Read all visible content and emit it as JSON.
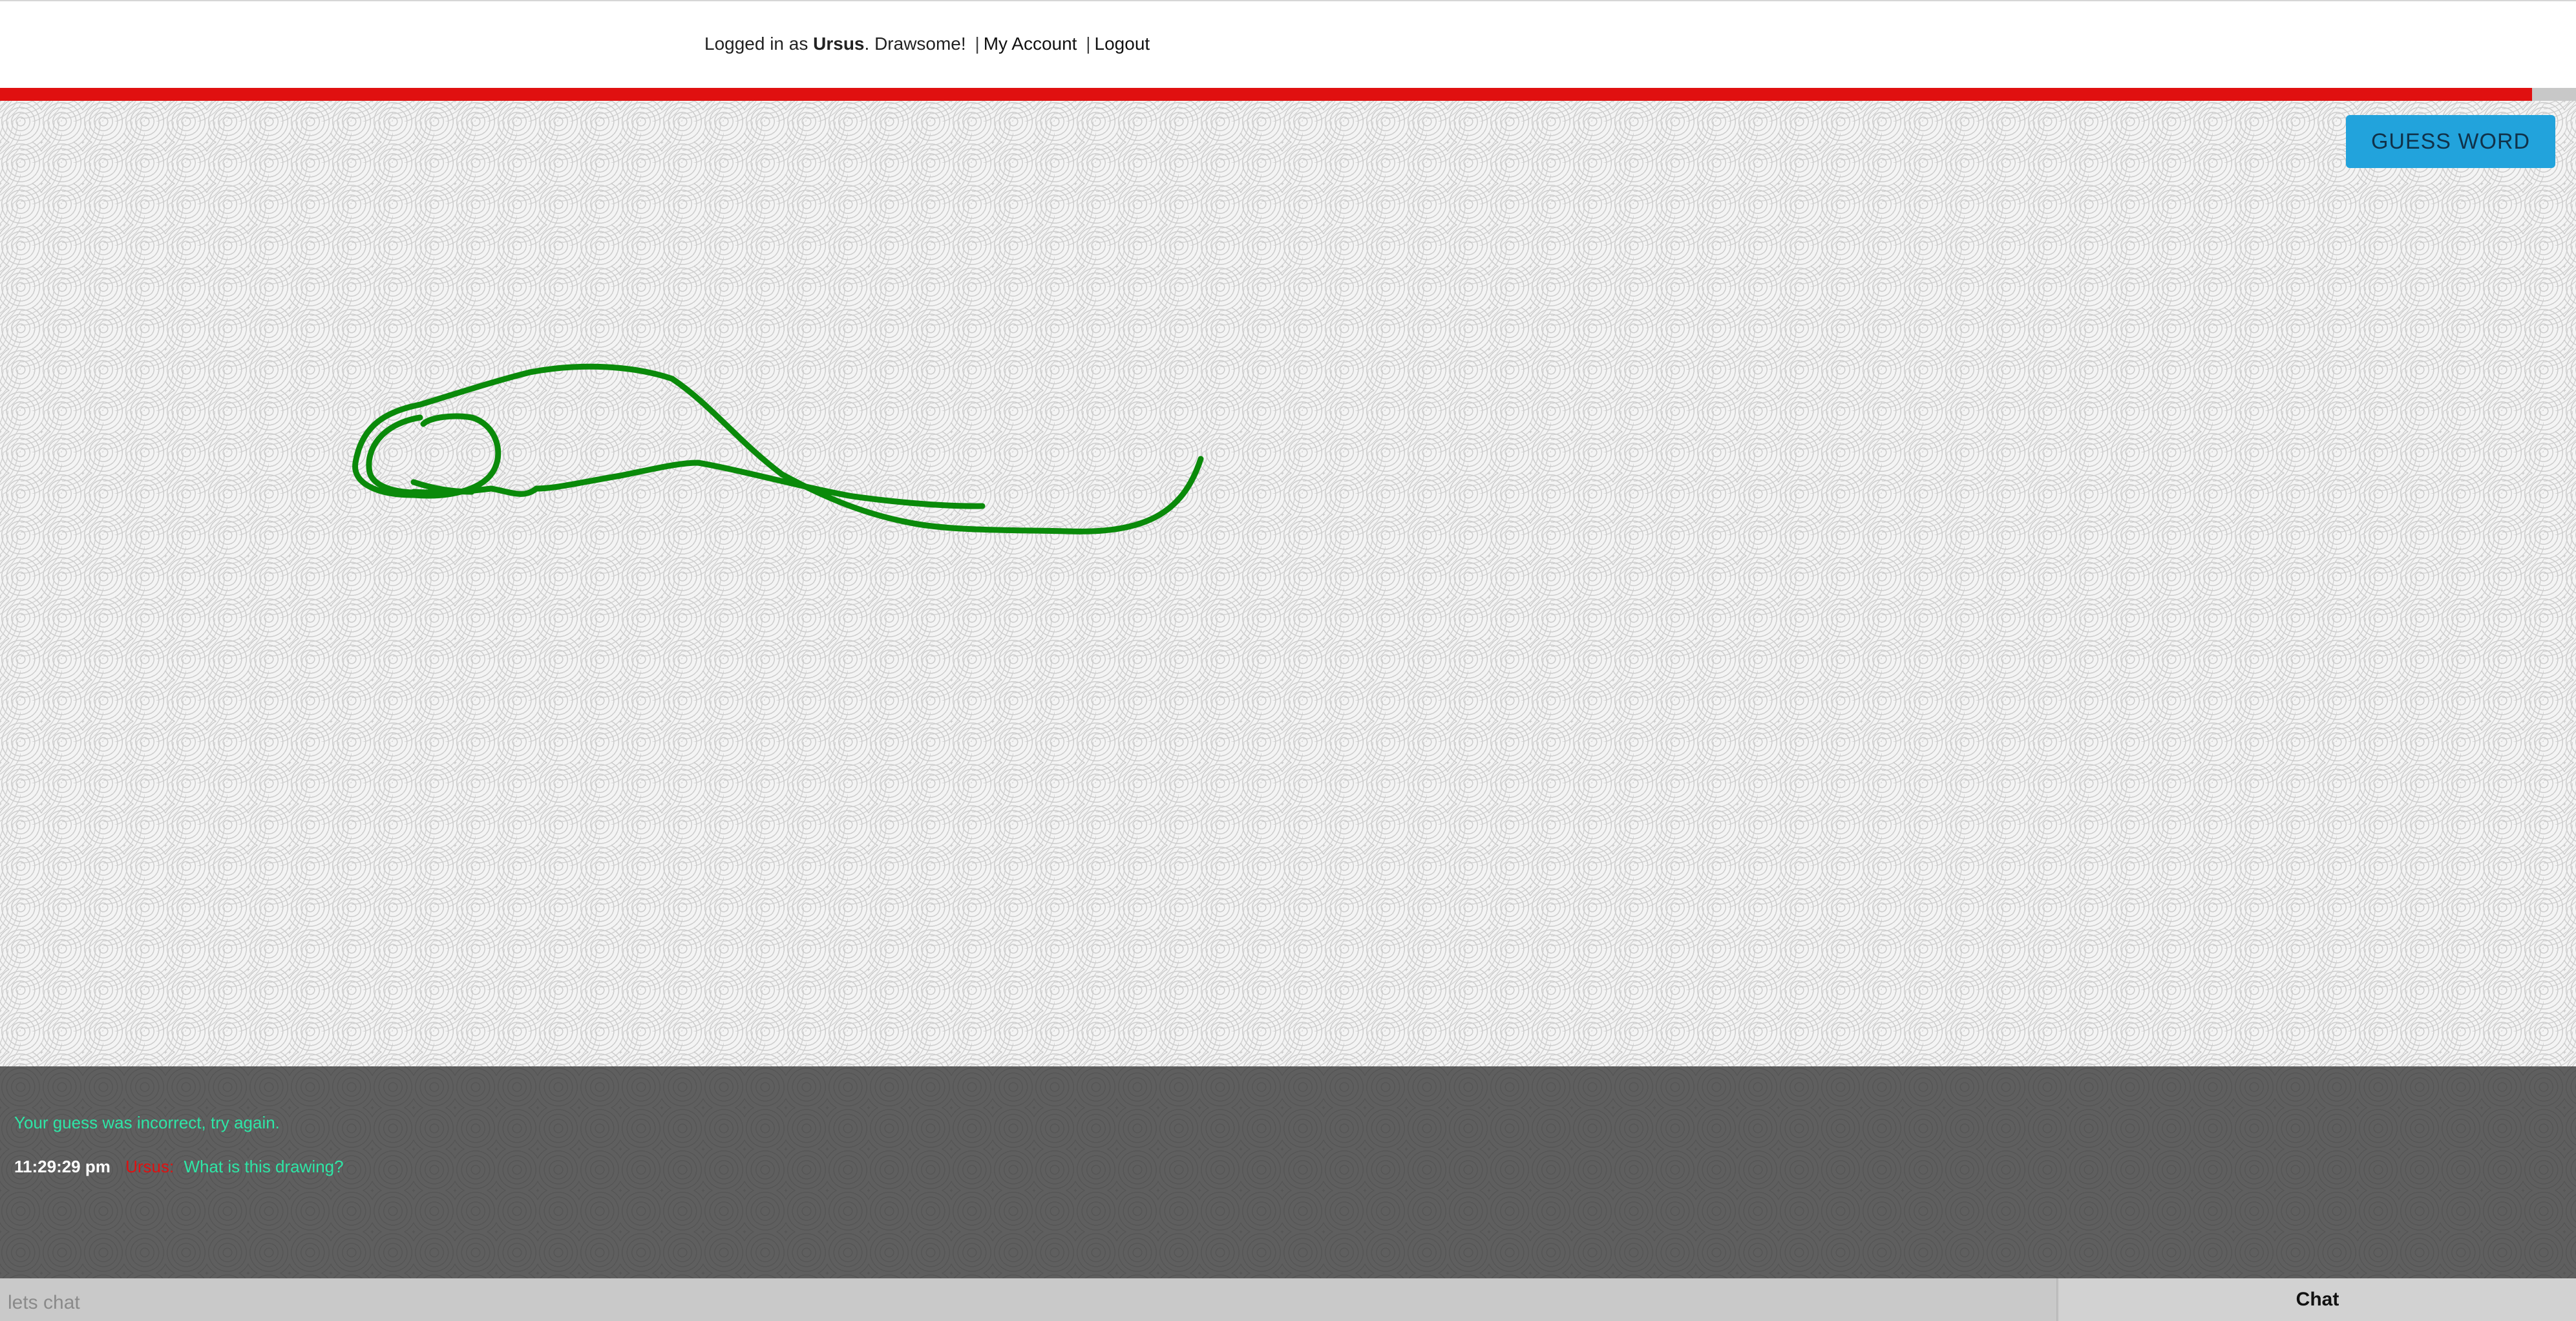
{
  "header": {
    "prefix": "Logged in as",
    "username": "Ursus",
    "tagline": ". Drawsome!",
    "separator": "|",
    "my_account": "My Account",
    "logout": "Logout"
  },
  "timer": {
    "remaining_fraction": 0.983,
    "fill_color": "#e01010"
  },
  "game": {
    "guess_button": "GUESS WORD",
    "stroke_color": "#0a8a0a"
  },
  "chat": {
    "system_message": "Your guess was incorrect, try again.",
    "messages": [
      {
        "time": "11:29:29 pm",
        "user": "Ursus:",
        "text": "What is this drawing?"
      }
    ],
    "input_placeholder": "lets chat",
    "send_label": "Chat"
  }
}
